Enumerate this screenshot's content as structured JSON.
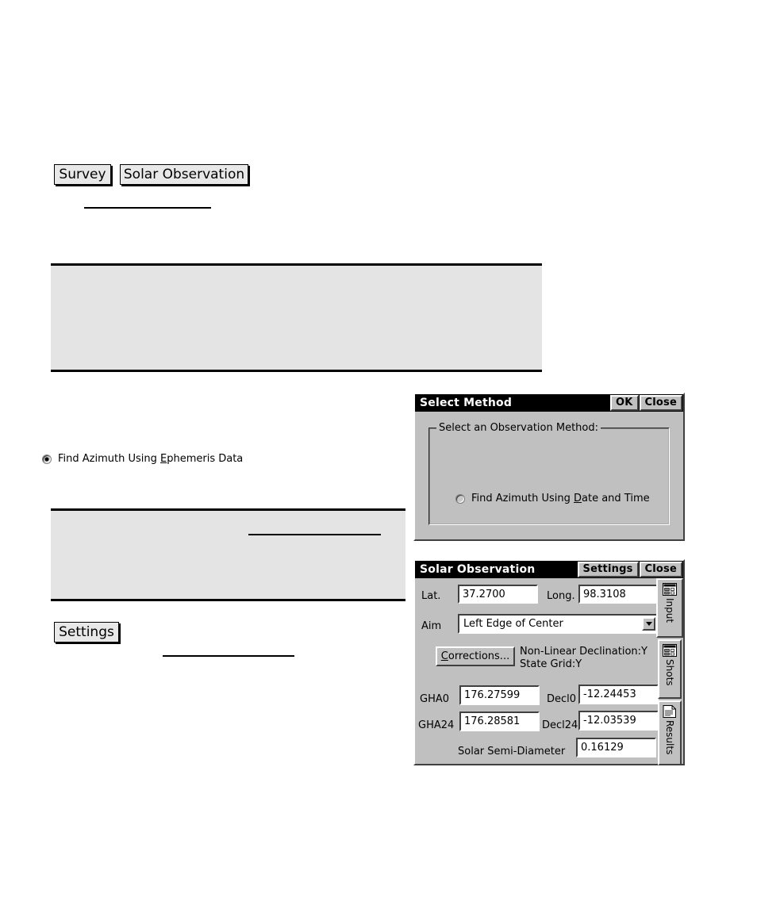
{
  "page": {
    "background": "#ffffff",
    "doc_buttons": [
      {
        "name": "survey",
        "label": "Survey"
      },
      {
        "name": "solar-observation",
        "label": "Solar Observation"
      },
      {
        "name": "settings",
        "label": "Settings"
      }
    ]
  },
  "select_method_dialog": {
    "title": "Select Method",
    "buttons": {
      "ok": "OK",
      "close": "Close"
    },
    "groupbox_legend": "Select an Observation Method:",
    "options": [
      {
        "pre": "Find Azimuth Using ",
        "accel": "E",
        "post": "phemeris Data",
        "full": "Find Azimuth Using Ephemeris Data",
        "selected": true
      },
      {
        "pre": "Find Azimuth Using ",
        "accel": "D",
        "post": "ate and Time",
        "full": "Find Azimuth Using Date and Time",
        "selected": false
      }
    ]
  },
  "solar_observation_dialog": {
    "title": "Solar Observation",
    "buttons": {
      "settings": "Settings",
      "close": "Close"
    },
    "fields": {
      "lat_label": "Lat.",
      "lat_value": "37.2700",
      "long_label": "Long.",
      "long_value": "98.3108",
      "aim_label": "Aim",
      "aim_value": "Left Edge of Center",
      "gha0_label": "GHA0",
      "gha0_value": "176.27599",
      "decl0_label": "Decl0",
      "decl0_value": "-12.24453",
      "gha24_label": "GHA24",
      "gha24_value": "176.28581",
      "decl24_label": "Decl24",
      "decl24_value": "-12.03539",
      "semidiameter_label": "Solar Semi-Diameter",
      "semidiameter_value": "0.16129"
    },
    "corrections": {
      "pre": "",
      "accel": "C",
      "post": "orrections...",
      "full": "Corrections...",
      "status_line1": "Non-Linear Declination:Y",
      "status_line2": "State Grid:Y"
    },
    "tabs": [
      {
        "label": "Input",
        "icon": "form-window-icon",
        "active": true
      },
      {
        "label": "Shots",
        "icon": "form-window-icon",
        "active": false
      },
      {
        "label": "Results",
        "icon": "document-lines-icon",
        "active": false
      }
    ]
  },
  "colors": {
    "dialog_face": "#c0c0c0",
    "titlebar": "#000000",
    "titlebar_text": "#ffffff",
    "field_bg": "#ffffff",
    "panel_grey": "#e4e4e4",
    "doc_button_face": "#e8e8e8"
  }
}
